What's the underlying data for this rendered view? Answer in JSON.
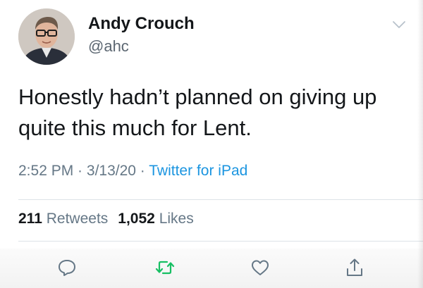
{
  "user": {
    "display_name": "Andy Crouch",
    "handle": "@ahc"
  },
  "tweet": {
    "text_line1": "Honestly hadn’t planned on giving up",
    "text_line2": "quite this much for Lent."
  },
  "meta": {
    "time": "2:52 PM",
    "separator": " · ",
    "date": "3/13/20",
    "source": "Twitter for iPad"
  },
  "stats": {
    "retweets_count": "211",
    "retweets_label": "Retweets",
    "likes_count": "1,052",
    "likes_label": "Likes"
  },
  "actions": {
    "reply_icon": "reply-icon",
    "retweet_icon": "retweet-icon",
    "like_icon": "heart-icon",
    "share_icon": "share-icon"
  },
  "colors": {
    "text": "#14171a",
    "secondary": "#657786",
    "link": "#1b95e0",
    "retweet": "#17bf63"
  }
}
